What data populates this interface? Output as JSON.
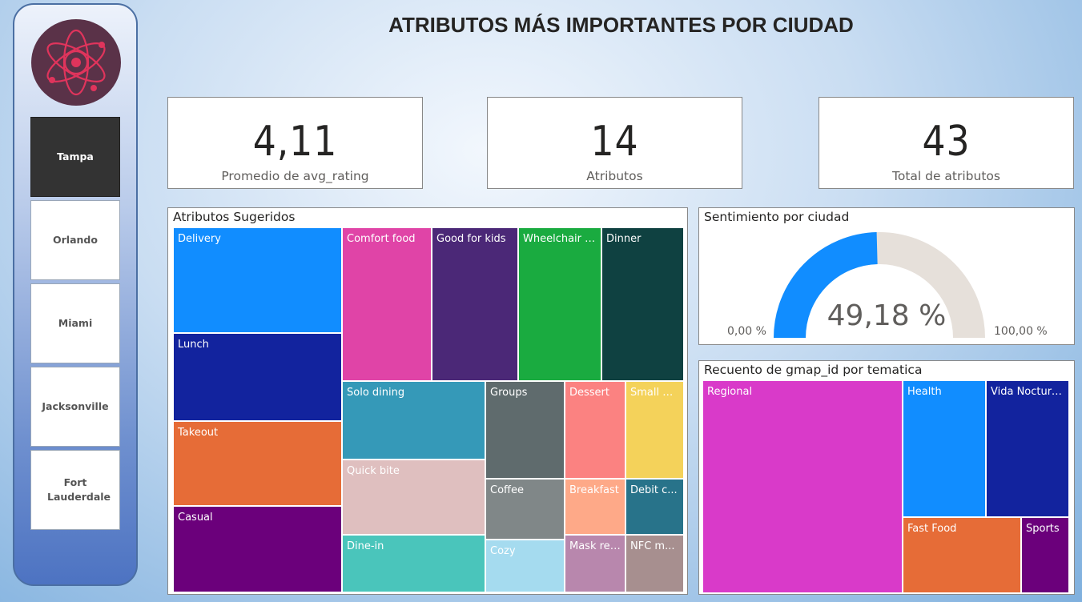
{
  "page_title": "ATRIBUTOS MÁS IMPORTANTES POR CIUDAD",
  "cities": [
    "Tampa",
    "Orlando",
    "Miami",
    "Jacksonville",
    "Fort Lauderdale"
  ],
  "selected_city": "Tampa",
  "kpi": [
    {
      "value": "4,11",
      "label": "Promedio de avg_rating"
    },
    {
      "value": "14",
      "label": "Atributos"
    },
    {
      "value": "43",
      "label": "Total de atributos"
    }
  ],
  "attributes_panel": {
    "title": "Atributos Sugeridos",
    "cells": [
      {
        "label": "Delivery",
        "color": "#118dff"
      },
      {
        "label": "Lunch",
        "color": "#12239e"
      },
      {
        "label": "Takeout",
        "color": "#e66c37"
      },
      {
        "label": "Casual",
        "color": "#6b007b"
      },
      {
        "label": "Comfort food",
        "color": "#e044a7"
      },
      {
        "label": "Good for kids",
        "color": "#4b2877"
      },
      {
        "label": "Wheelchair a...",
        "color": "#1aab40"
      },
      {
        "label": "Dinner",
        "color": "#0f4141"
      },
      {
        "label": "Solo dining",
        "color": "#3599b8"
      },
      {
        "label": "Quick bite",
        "color": "#dfbfbf"
      },
      {
        "label": "Dine-in",
        "color": "#4ac5bb"
      },
      {
        "label": "Groups",
        "color": "#5f6b6d"
      },
      {
        "label": "Coffee",
        "color": "#808788"
      },
      {
        "label": "Cozy",
        "color": "#a5dbef"
      },
      {
        "label": "Dessert",
        "color": "#fb8281"
      },
      {
        "label": "Breakfast",
        "color": "#fea988"
      },
      {
        "label": "Mask req...",
        "color": "#b887ad"
      },
      {
        "label": "Small pl...",
        "color": "#f4d25a"
      },
      {
        "label": "Debit c...",
        "color": "#28738a"
      },
      {
        "label": "NFC m...",
        "color": "#a78f8f"
      }
    ]
  },
  "sentiment_panel": {
    "title": "Sentimiento por ciudad",
    "value_text": "49,18 %",
    "value": 49.18,
    "min_text": "0,00 %",
    "max_text": "100,00 %",
    "fill_color": "#118dff",
    "track_color": "#e6e0da"
  },
  "tematica_panel": {
    "title": "Recuento de gmap_id por tematica",
    "cells": [
      {
        "label": "Regional",
        "color": "#d93ac9"
      },
      {
        "label": "Health",
        "color": "#118dff"
      },
      {
        "label": "Vida Nocturna",
        "color": "#12239e"
      },
      {
        "label": "Fast Food",
        "color": "#e66c37"
      },
      {
        "label": "Sports",
        "color": "#6b007b"
      }
    ]
  }
}
